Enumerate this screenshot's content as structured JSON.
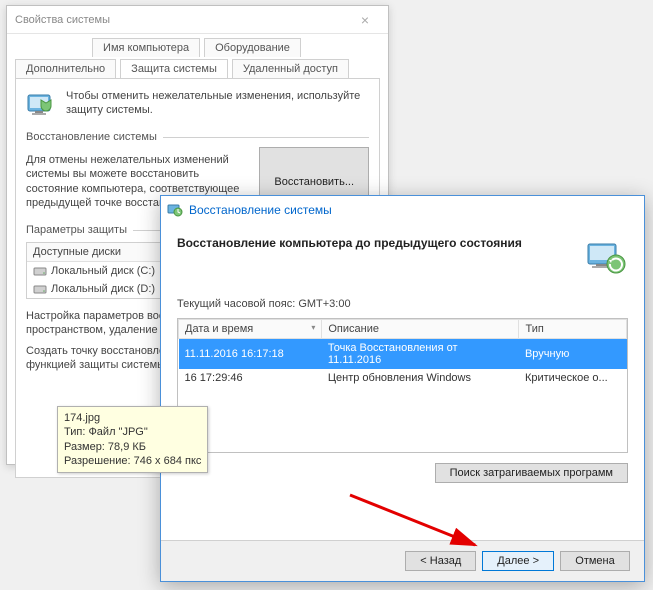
{
  "back": {
    "title": "Свойства системы",
    "tabs": {
      "r1a": "Имя компьютера",
      "r1b": "Оборудование",
      "r2a": "Дополнительно",
      "r2b": "Защита системы",
      "r2c": "Удаленный доступ"
    },
    "info": "Чтобы отменить нежелательные изменения, используйте защиту системы.",
    "group_restore": "Восстановление системы",
    "restore_desc": "Для отмены нежелательных изменений системы вы можете восстановить состояние компьютера, соответствующее предыдущей точке восстановления.",
    "restore_btn": "Восстановить...",
    "group_protect": "Параметры защиты",
    "disks_header": "Доступные диски",
    "disk_c": "Локальный диск (C:)",
    "disk_d": "Локальный диск (D:)",
    "config_desc": "Настройка параметров восстановления, управление дисковым пространством, удаление точек восстановления.",
    "create_desc": "Создать точку восстановления для дисков с включенной функцией защиты системы."
  },
  "tooltip": {
    "l1": "174.jpg",
    "l2": "Тип: Файл \"JPG\"",
    "l3": "Размер: 78,9 КБ",
    "l4": "Разрешение: 746 x 684 пкс"
  },
  "front": {
    "title": "Восстановление системы",
    "heading": "Восстановление компьютера до предыдущего состояния",
    "tz": "Текущий часовой пояс: GMT+3:00",
    "cols": {
      "dt": "Дата и время",
      "desc": "Описание",
      "type": "Тип"
    },
    "rows": [
      {
        "dt": "11.11.2016 16:17:18",
        "desc": "Точка Восстановления от 11.11.2016",
        "type": "Вручную",
        "selected": true
      },
      {
        "dt": "16 17:29:46",
        "desc": "Центр обновления Windows",
        "type": "Критическое о...",
        "selected": false
      }
    ],
    "scan_btn": "Поиск затрагиваемых программ",
    "back_btn": "< Назад",
    "next_btn": "Далее >",
    "cancel_btn": "Отмена"
  }
}
